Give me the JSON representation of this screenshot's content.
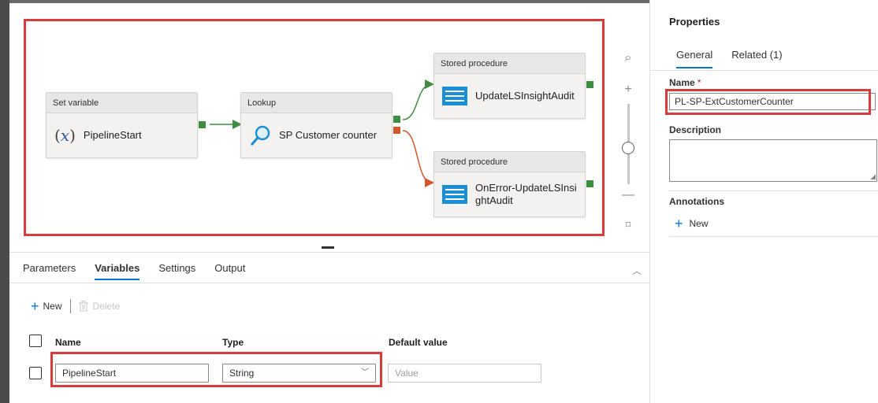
{
  "canvas": {
    "activities": [
      {
        "type": "Set variable",
        "name": "PipelineStart",
        "icon": "variable-icon"
      },
      {
        "type": "Lookup",
        "name": "SP Customer counter",
        "icon": "magnifier-icon"
      },
      {
        "type": "Stored procedure",
        "name": "UpdateLSInsightAudit",
        "icon": "stored-procedure-icon"
      },
      {
        "type": "Stored procedure",
        "name": "OnError-UpdateLSInsightAudit",
        "name_line1": "OnError-UpdateLSInsi",
        "name_line2": "ghtAudit",
        "icon": "stored-procedure-icon"
      }
    ],
    "variable_symbol": "𝑥",
    "success_color": "#3e8e41",
    "failure_color": "#d1562c",
    "highlight_color": "#d83b3b"
  },
  "bottom_panel": {
    "tabs": [
      "Parameters",
      "Variables",
      "Settings",
      "Output"
    ],
    "active_tab": "Variables",
    "toolbar": {
      "new_label": "New",
      "delete_label": "Delete"
    },
    "columns": [
      "Name",
      "Type",
      "Default value"
    ],
    "rows": [
      {
        "name": "PipelineStart",
        "type": "String",
        "default_placeholder": "Value"
      }
    ]
  },
  "properties": {
    "title": "Properties",
    "tabs": [
      "General",
      "Related (1)"
    ],
    "active_tab": "General",
    "name_label": "Name",
    "required_marker": "*",
    "name_value": "PL-SP-ExtCustomerCounter",
    "description_label": "Description",
    "annotations_label": "Annotations",
    "annotations_new_label": "New"
  }
}
